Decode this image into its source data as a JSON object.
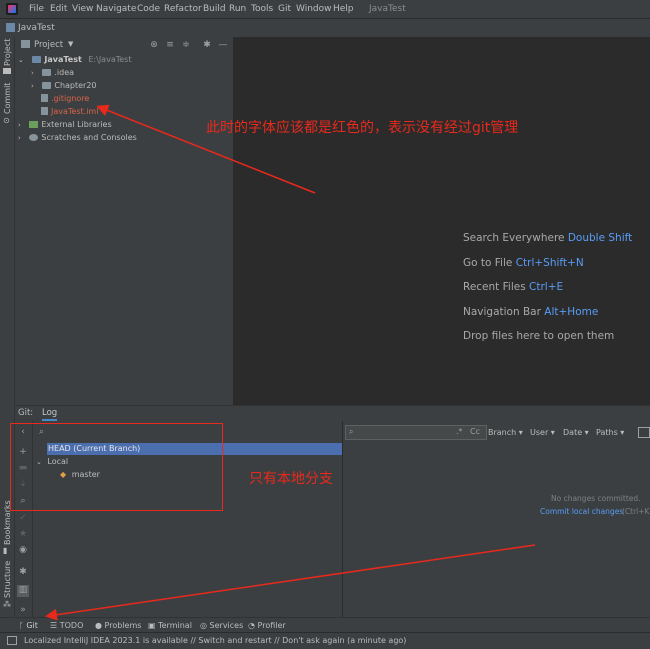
{
  "menu": {
    "items": [
      "File",
      "Edit",
      "View",
      "Navigate",
      "Code",
      "Refactor",
      "Build",
      "Run",
      "Tools",
      "Git",
      "Window",
      "Help"
    ],
    "title": "JavaTest"
  },
  "navbar": {
    "crumb": "JavaTest"
  },
  "left_strip": {
    "project": "Project",
    "commit": "Commit",
    "bookmarks": "Bookmarks",
    "structure": "Structure"
  },
  "project_panel": {
    "title": "Project",
    "tree": [
      {
        "label": "JavaTest",
        "path": "E:\\JavaTest"
      },
      {
        "label": ".idea"
      },
      {
        "label": "Chapter20"
      },
      {
        "label": ".gitignore"
      },
      {
        "label": "JavaTest.iml"
      },
      {
        "label": "External Libraries"
      },
      {
        "label": "Scratches and Consoles"
      }
    ]
  },
  "editor_hints": [
    {
      "text": "Search Everywhere",
      "key": "Double Shift"
    },
    {
      "text": "Go to File",
      "key": "Ctrl+Shift+N"
    },
    {
      "text": "Recent Files",
      "key": "Ctrl+E"
    },
    {
      "text": "Navigation Bar",
      "key": "Alt+Home"
    },
    {
      "text": "Drop files here to open them",
      "key": ""
    }
  ],
  "git_panel": {
    "tab_git": "Git:",
    "tab_log": "Log",
    "branches": {
      "head": "HEAD (Current Branch)",
      "local": "Local",
      "master": "master"
    },
    "filters": {
      "branch": "Branch",
      "user": "User",
      "date": "Date",
      "paths": "Paths",
      "cc": "Cc"
    },
    "empty": {
      "message": "No changes committed.",
      "link": "Commit local changes",
      "shortcut": "(Ctrl+K)"
    }
  },
  "bottom_tabs": [
    "Git",
    "TODO",
    "Problems",
    "Terminal",
    "Services",
    "Profiler"
  ],
  "status": "Localized IntelliJ IDEA 2023.1 is available // Switch and restart // Don't ask again (a minute ago)",
  "annotations": {
    "top": "此时的字体应该都是红色的，表示没有经过git管理",
    "middle": "只有本地分支"
  },
  "colors": {
    "annotation": "#e8291c",
    "ignored_file": "#d9634a",
    "link": "#589df6",
    "selection": "#4b6eaf"
  }
}
